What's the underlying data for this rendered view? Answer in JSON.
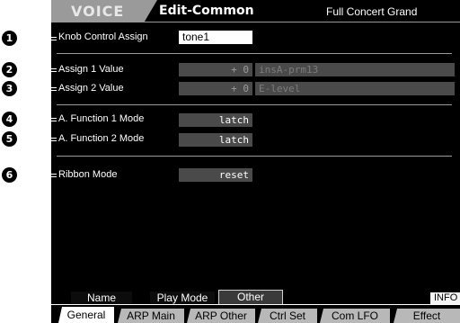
{
  "header": {
    "mode": "VOICE",
    "title": "Edit-Common",
    "voice_name": "Full Concert Grand"
  },
  "params": [
    {
      "callout": "1",
      "label": "Knob Control Assign",
      "value": "tone1"
    },
    {
      "callout": "2",
      "label": "Assign 1 Value",
      "value": "+ 0",
      "sub": "insA-prm13"
    },
    {
      "callout": "3",
      "label": "Assign 2 Value",
      "value": "+ 0",
      "sub": "E-level"
    },
    {
      "callout": "4",
      "label": "A. Function 1 Mode",
      "value": "latch"
    },
    {
      "callout": "5",
      "label": "A. Function 2 Mode",
      "value": "latch"
    },
    {
      "callout": "6",
      "label": "Ribbon Mode",
      "value": "reset"
    }
  ],
  "subtabs": [
    "Name",
    "Play Mode",
    "Other"
  ],
  "active_subtab": "Other",
  "info_label": "INFO",
  "maintabs": [
    "General",
    "ARP Main",
    "ARP Other",
    "Ctrl Set",
    "Com LFO",
    "Effect"
  ],
  "active_maintab": "General",
  "colors": {
    "background": "#000000",
    "highlight": "#ffffff",
    "field": "#4a4a4a",
    "divider": "#9a9a9a",
    "tab": "#b8b8b8"
  },
  "icons": [
    "callout-number-icon"
  ]
}
